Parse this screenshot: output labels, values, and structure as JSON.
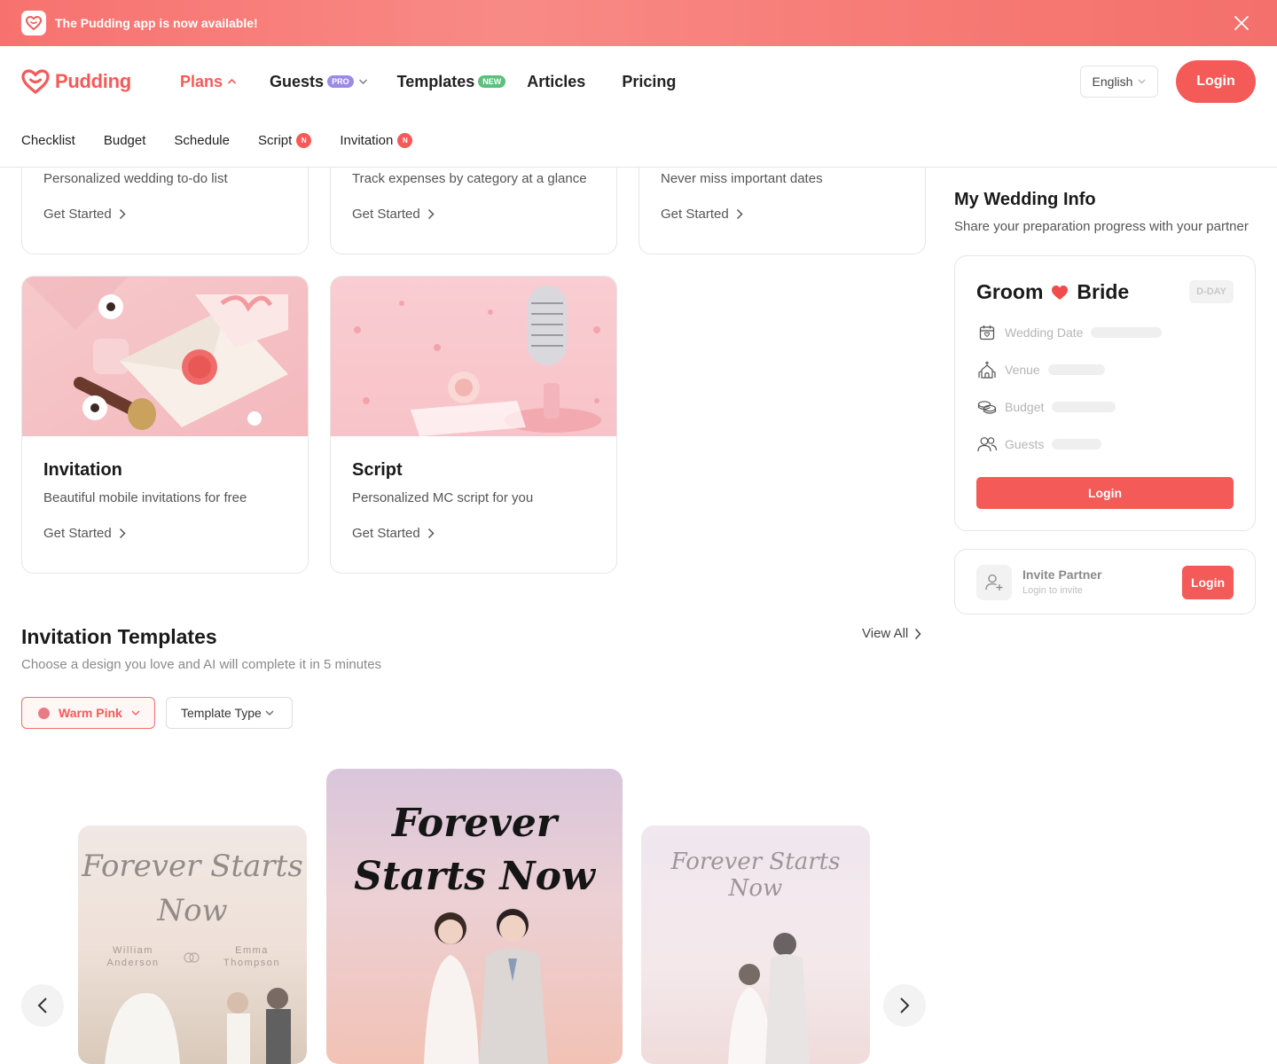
{
  "banner": {
    "text": "The Pudding app is now available!"
  },
  "brand": {
    "name": "Pudding",
    "accent": "#f45a57"
  },
  "nav": {
    "plans": "Plans",
    "guests": "Guests",
    "guests_badge": "PRO",
    "templates": "Templates",
    "templates_badge": "NEW",
    "articles": "Articles",
    "pricing": "Pricing"
  },
  "header": {
    "language": "English",
    "login": "Login"
  },
  "subnav": {
    "checklist": "Checklist",
    "budget": "Budget",
    "schedule": "Schedule",
    "script": "Script",
    "invitation": "Invitation",
    "badge": "N"
  },
  "cards": [
    {
      "desc": "Personalized wedding to-do list",
      "cta": "Get Started"
    },
    {
      "desc": "Track expenses by category at a glance",
      "cta": "Get Started"
    },
    {
      "desc": "Never miss important dates",
      "cta": "Get Started"
    },
    {
      "title": "Invitation",
      "desc": "Beautiful mobile invitations for free",
      "cta": "Get Started"
    },
    {
      "title": "Script",
      "desc": "Personalized MC script for you",
      "cta": "Get Started"
    }
  ],
  "templates_section": {
    "title": "Invitation Templates",
    "subtitle": "Choose a design you love and AI will complete it in 5 minutes",
    "view_all": "View All",
    "color_filter": "Warm Pink",
    "type_filter": "Template Type",
    "items": [
      {
        "title_line1": "Forever Starts",
        "title_line2": "Now",
        "groom": "William Anderson",
        "groom_first": "William",
        "groom_last": "Anderson",
        "bride_first": "Emma",
        "bride_last": "Thompson"
      },
      {
        "title_line1": "Forever",
        "title_line2": "Starts Now"
      },
      {
        "title_line1": "Forever Starts Now"
      }
    ]
  },
  "wedding_info": {
    "title": "My Wedding Info",
    "subtitle": "Share your preparation progress with your partner",
    "groom": "Groom",
    "bride": "Bride",
    "dday": "D-DAY",
    "rows": {
      "date": "Wedding Date",
      "venue": "Venue",
      "budget": "Budget",
      "guests": "Guests"
    },
    "login": "Login"
  },
  "invite": {
    "name": "Invite Partner",
    "hint": "Login to invite",
    "login": "Login"
  }
}
